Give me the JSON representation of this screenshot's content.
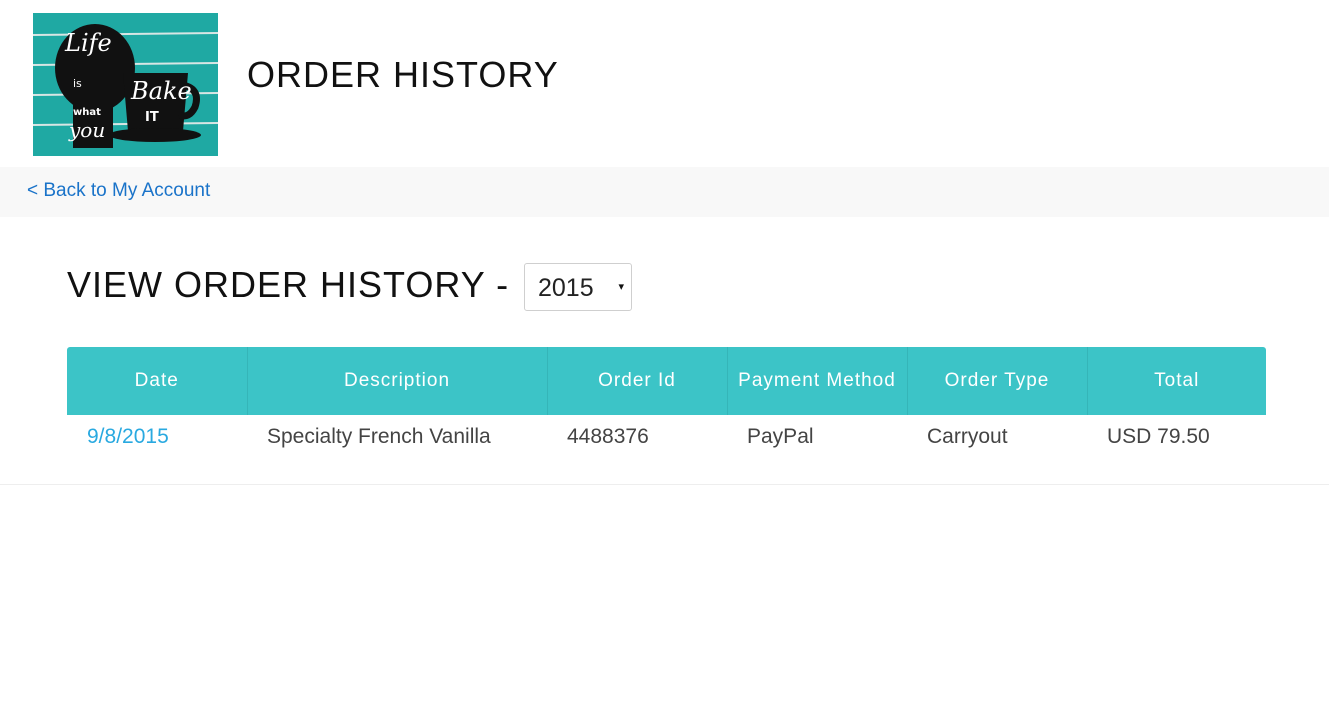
{
  "header": {
    "logo_text": [
      "Life",
      "is",
      "Bake",
      "IT",
      "what",
      "you"
    ],
    "title": "ORDER HISTORY"
  },
  "nav": {
    "back_link": "< Back to My Account"
  },
  "history": {
    "heading": "VIEW ORDER HISTORY -",
    "year_selected": "2015",
    "year_arrow": "▾"
  },
  "table": {
    "columns": [
      "Date",
      "Description",
      "Order Id",
      "Payment Method",
      "Order Type",
      "Total"
    ],
    "rows": [
      {
        "date": "9/8/2015",
        "description": "Specialty French Vanilla",
        "order_id": "4488376",
        "payment_method": "PayPal",
        "order_type": "Carryout",
        "total": "USD 79.50"
      }
    ]
  },
  "colors": {
    "table_header": "#3cc4c7",
    "link_blue": "#1a73c9",
    "date_link": "#29a9e0",
    "logo_teal": "#1fa9a3"
  }
}
